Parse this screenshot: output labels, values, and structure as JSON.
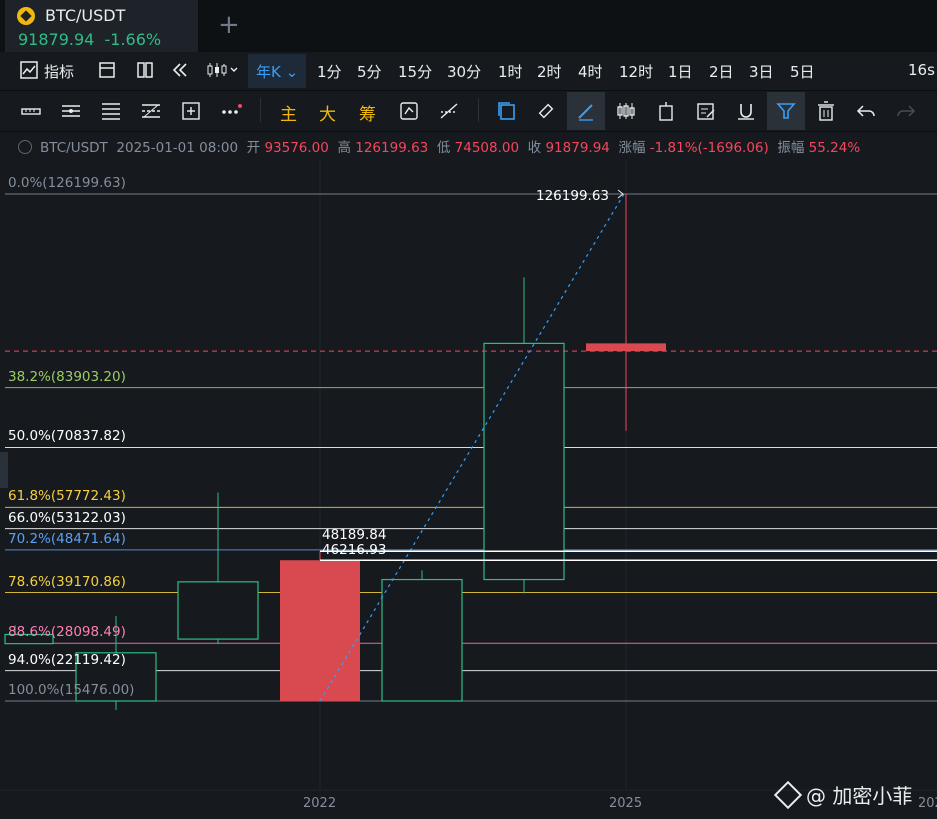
{
  "tab": {
    "title": "BTC/USDT",
    "price": "91879.94",
    "change": "-1.66%",
    "add_icon": "+"
  },
  "toolbar_timeframes": {
    "indicator_label": "指标",
    "items": [
      "年K",
      "1分",
      "5分",
      "15分",
      "30分",
      "1时",
      "2时",
      "4时",
      "12时",
      "1日",
      "2日",
      "3日",
      "5日"
    ],
    "active": "年K",
    "countdown": "16s"
  },
  "toolbar_tools": {
    "main_label": "主",
    "big_label": "大",
    "chip_label": "筹"
  },
  "info": {
    "symbol": "BTC/USDT",
    "datetime": "2025-01-01 08:00",
    "open_label": "开",
    "open": "93576.00",
    "high_label": "高",
    "high": "126199.63",
    "low_label": "低",
    "low": "74508.00",
    "close_label": "收",
    "close": "91879.94",
    "change_label": "涨幅",
    "change": "-1.81%(-1696.06)",
    "amp_label": "振幅",
    "amp": "55.24%"
  },
  "chart_data": {
    "type": "candlestick",
    "x_ticks": [
      "2022",
      "2025",
      "202"
    ],
    "candles": [
      {
        "open": 28000,
        "close": 30000,
        "high": 32000,
        "low": 28000
      },
      {
        "open": 15476,
        "close": 26000,
        "high": 34000,
        "low": 13500
      },
      {
        "open": 29000,
        "close": 41500,
        "high": 61000,
        "low": 27900
      },
      {
        "open": 46216.93,
        "close": 15476,
        "high": 48189.84,
        "low": 15476
      },
      {
        "open": 15476,
        "close": 42000,
        "high": 44000,
        "low": 15476
      },
      {
        "open": 42000,
        "close": 93576,
        "high": 108000,
        "low": 39000
      },
      {
        "open": 93576,
        "close": 91879.94,
        "high": 126199.63,
        "low": 74508
      }
    ],
    "current_price": 91879.94,
    "fibonacci": [
      {
        "label": "0.0%(126199.63)",
        "value": 126199.63,
        "color": "#848e9c"
      },
      {
        "label": "38.2%(83903.20)",
        "value": 83903.2,
        "color": "#9ccc65"
      },
      {
        "label": "50.0%(70837.82)",
        "value": 70837.82,
        "color": "#ffffff"
      },
      {
        "label": "61.8%(57772.43)",
        "value": 57772.43,
        "color": "#f4d03f"
      },
      {
        "label": "66.0%(53122.03)",
        "value": 53122.03,
        "color": "#ffffff"
      },
      {
        "label": "70.2%(48471.64)",
        "value": 48471.64,
        "color": "#5aa0f0"
      },
      {
        "label": "78.6%(39170.86)",
        "value": 39170.86,
        "color": "#f4d03f"
      },
      {
        "label": "88.6%(28098.49)",
        "value": 28098.49,
        "color": "#ff7eb6"
      },
      {
        "label": "94.0%(22119.42)",
        "value": 22119.42,
        "color": "#ffffff"
      },
      {
        "label": "100.0%(15476.00)",
        "value": 15476.0,
        "color": "#848e9c"
      }
    ],
    "annotations": [
      "126199.63",
      "48189.84",
      "46216.93"
    ]
  },
  "watermark": "@ 加密小菲",
  "colors": {
    "up": "#2ebd85",
    "down": "#f6465d",
    "accent": "#3a9ef5"
  }
}
